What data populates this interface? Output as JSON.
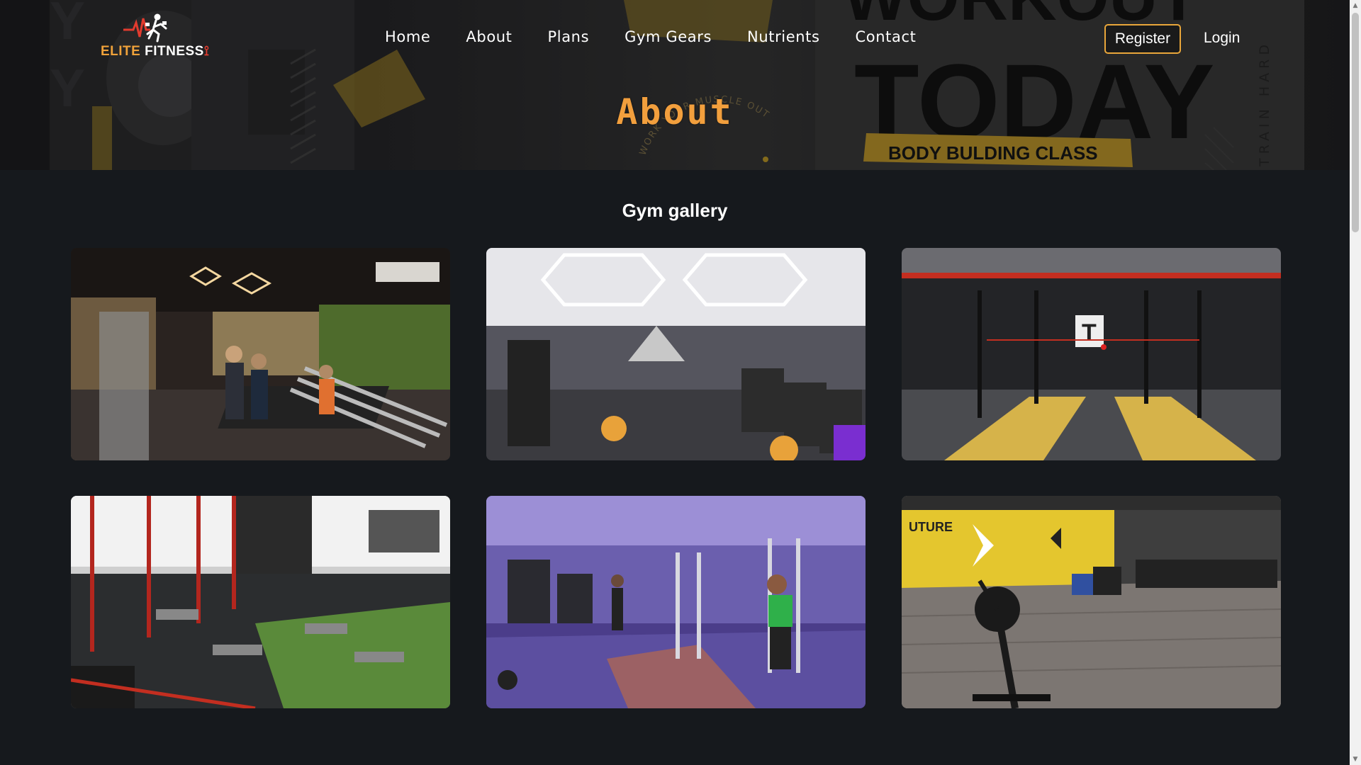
{
  "brand": {
    "part1": "ELITE",
    "part2": "FITNESS"
  },
  "nav": {
    "items": [
      "Home",
      "About",
      "Plans",
      "Gym Gears",
      "Nutrients",
      "Contact"
    ],
    "register": "Register",
    "login": "Login"
  },
  "hero": {
    "title": "About",
    "bg_texts": [
      "WORKOUT",
      "TODAY",
      "BODY BULDING CLASS",
      "TRAIN HARD",
      "WORK YOUR MUSCLE OUT"
    ]
  },
  "gallery": {
    "title": "Gym gallery",
    "photos": [
      "gym-photo-1",
      "gym-photo-2",
      "gym-photo-3",
      "gym-photo-4",
      "gym-photo-5",
      "gym-photo-6"
    ]
  },
  "colors": {
    "accent": "#f29f3d",
    "background": "#16191d",
    "button_border": "#e9a63a"
  }
}
